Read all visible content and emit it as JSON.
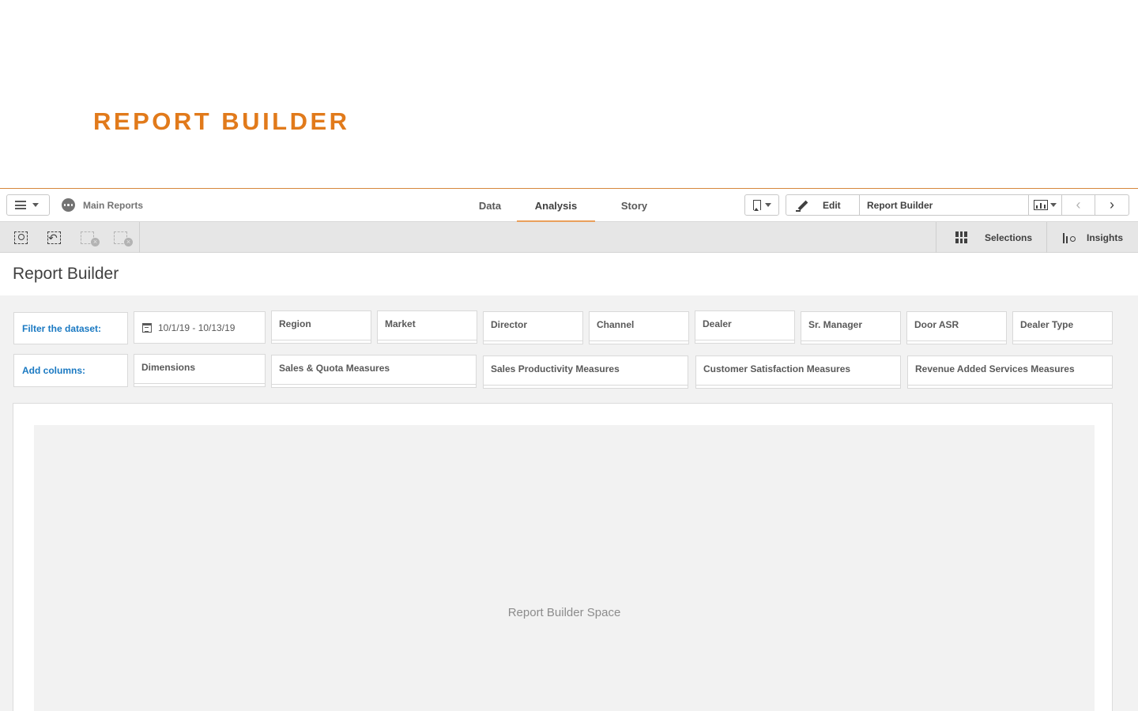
{
  "banner": {
    "title": "REPORT BUILDER"
  },
  "toolbar": {
    "app_name": "Main Reports",
    "tabs": [
      {
        "label": "Data",
        "active": false
      },
      {
        "label": "Analysis",
        "active": true
      },
      {
        "label": "Story",
        "active": false
      }
    ],
    "edit_label": "Edit",
    "sheet_name": "Report Builder",
    "prev_arrow": "‹",
    "next_arrow": "›"
  },
  "selection_bar": {
    "tools": [
      "smart-search-icon",
      "step-back-icon",
      "step-forward-icon",
      "clear-selections-icon"
    ],
    "selections_label": "Selections",
    "insights_label": "Insights"
  },
  "sheet": {
    "title": "Report Builder"
  },
  "filters": {
    "label": "Filter the dataset:",
    "date_range": "10/1/19 - 10/13/19",
    "fields": [
      "Region",
      "Market",
      "Director",
      "Channel",
      "Dealer",
      "Sr. Manager",
      "Door ASR",
      "Dealer Type"
    ]
  },
  "columns": {
    "label": "Add columns:",
    "groups": [
      "Dimensions",
      "Sales & Quota Measures",
      "Sales Productivity Measures",
      "Customer Satisfaction Measures",
      "Revenue Added Services Measures"
    ]
  },
  "builder": {
    "placeholder": "Report Builder Space"
  },
  "colors": {
    "accent": "#e17a1b",
    "link": "#1a79c2",
    "tab_underline": "#e99f5b"
  }
}
